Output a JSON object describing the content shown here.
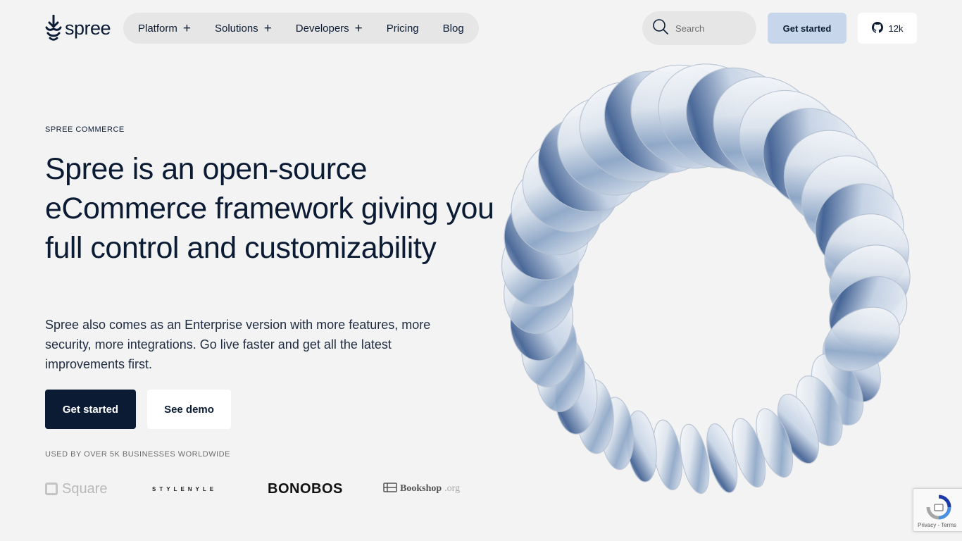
{
  "header": {
    "logo_text": "spree",
    "nav": [
      {
        "label": "Platform",
        "has_plus": true
      },
      {
        "label": "Solutions",
        "has_plus": true
      },
      {
        "label": "Developers",
        "has_plus": true
      },
      {
        "label": "Pricing",
        "has_plus": false
      },
      {
        "label": "Blog",
        "has_plus": false
      }
    ],
    "search_placeholder": "Search",
    "get_started_label": "Get started",
    "github_stars": "12k"
  },
  "hero": {
    "eyebrow": "SPREE COMMERCE",
    "headline": "Spree is an open-source eCommerce framework giving you full control and customizability",
    "subtext": "Spree also comes as an Enterprise version with more features, more security, more integrations. Go live faster and get all the latest improvements first.",
    "primary_cta": "Get started",
    "secondary_cta": "See demo",
    "used_by": "USED BY OVER 5K BUSINESSES WORLDWIDE"
  },
  "brands": {
    "square": "Square",
    "stylenyle": "STYLENYLE",
    "bonobos": "BONOBOS",
    "bookshop": "Bookshop",
    "bookshop_suffix": ".org"
  },
  "recaptcha": {
    "privacy": "Privacy",
    "terms": "Terms"
  },
  "colors": {
    "background": "#f3f3f3",
    "navy": "#0b1b33",
    "nav_pill": "#e6e6e6",
    "accent_button": "#c7d6ea"
  },
  "icons": [
    "spree-logo-icon",
    "plus-icon",
    "search-icon",
    "github-icon",
    "recaptcha-icon"
  ]
}
